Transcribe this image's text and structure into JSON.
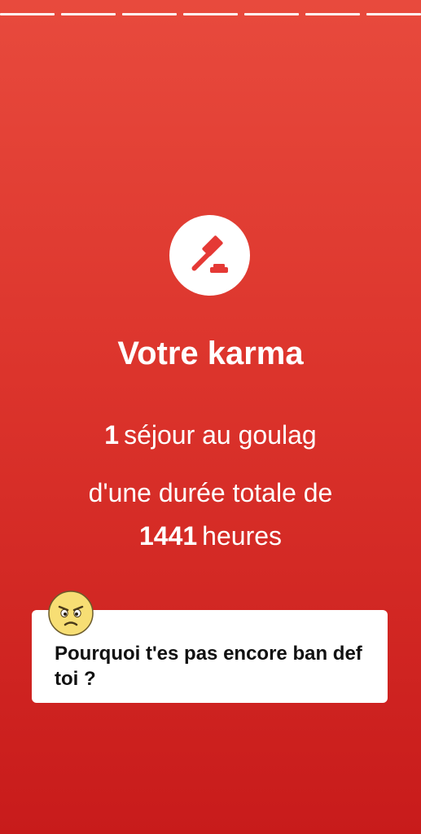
{
  "story": {
    "progress_segments": 7
  },
  "emblem": {
    "icon": "gavel-icon",
    "accent": "#e53935"
  },
  "title": "Votre karma",
  "stats": {
    "stays_count": "1",
    "stays_label": "séjour au goulag",
    "duration_prefix": "d'une durée totale de",
    "hours_count": "1441",
    "hours_label": "heures"
  },
  "comment": {
    "avatar_icon": "angry-face-icon",
    "text": "Pourquoi t'es pas encore ban def toi ?"
  },
  "colors": {
    "background_top": "#e84a3d",
    "background_bottom": "#c81b1b",
    "card": "#ffffff",
    "text": "#ffffff"
  }
}
